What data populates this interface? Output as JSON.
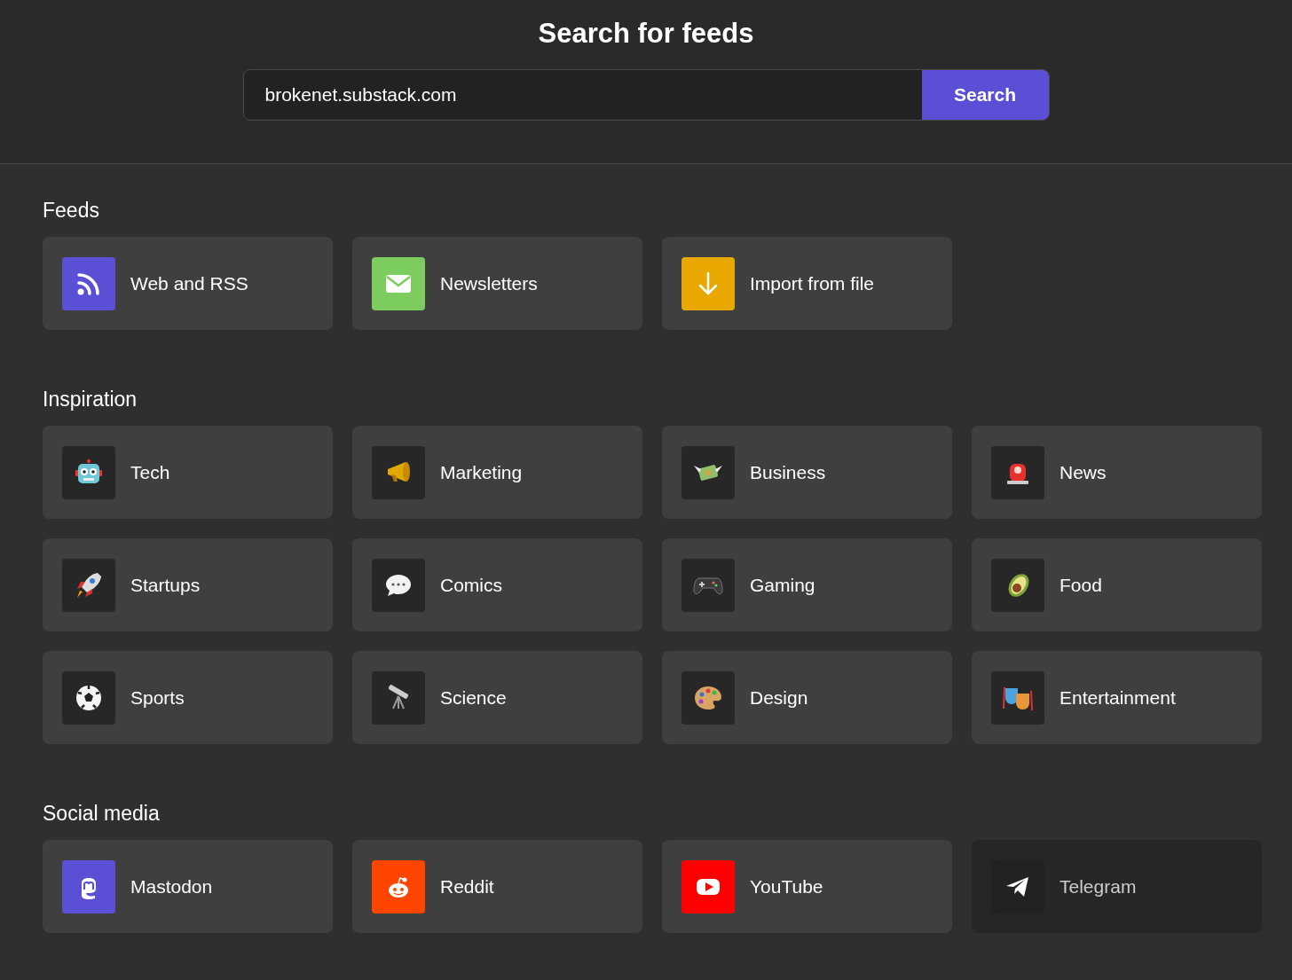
{
  "title": "Search for feeds",
  "search": {
    "value": "brokenet.substack.com",
    "button": "Search"
  },
  "sections": [
    {
      "title": "Feeds",
      "items": [
        {
          "label": "Web and RSS",
          "color": "#5b4fd6",
          "disabled": false
        },
        {
          "label": "Newsletters",
          "color": "#7ccc5e",
          "disabled": false
        },
        {
          "label": "Import from file",
          "color": "#e8a800",
          "disabled": false
        }
      ]
    },
    {
      "title": "Inspiration",
      "items": [
        {
          "label": "Tech",
          "color": "#272727",
          "disabled": false
        },
        {
          "label": "Marketing",
          "color": "#272727",
          "disabled": false
        },
        {
          "label": "Business",
          "color": "#272727",
          "disabled": false
        },
        {
          "label": "News",
          "color": "#272727",
          "disabled": false
        },
        {
          "label": "Startups",
          "color": "#272727",
          "disabled": false
        },
        {
          "label": "Comics",
          "color": "#272727",
          "disabled": false
        },
        {
          "label": "Gaming",
          "color": "#272727",
          "disabled": false
        },
        {
          "label": "Food",
          "color": "#272727",
          "disabled": false
        },
        {
          "label": "Sports",
          "color": "#272727",
          "disabled": false
        },
        {
          "label": "Science",
          "color": "#272727",
          "disabled": false
        },
        {
          "label": "Design",
          "color": "#272727",
          "disabled": false
        },
        {
          "label": "Entertainment",
          "color": "#272727",
          "disabled": false
        }
      ]
    },
    {
      "title": "Social media",
      "items": [
        {
          "label": "Mastodon",
          "color": "#5b4fd6",
          "disabled": false
        },
        {
          "label": "Reddit",
          "color": "#ff4500",
          "disabled": false
        },
        {
          "label": "YouTube",
          "color": "#ff0000",
          "disabled": false
        },
        {
          "label": "Telegram",
          "color": "#222222",
          "disabled": true
        }
      ]
    }
  ]
}
